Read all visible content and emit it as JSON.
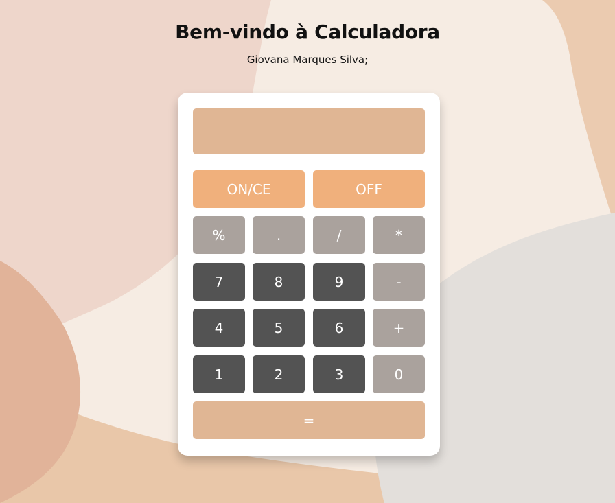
{
  "header": {
    "title": "Bem-vindo à Calculadora",
    "subtitle": "Giovana Marques Silva;"
  },
  "display": {
    "value": ""
  },
  "buttons": {
    "on_ce": "ON/CE",
    "off": "OFF",
    "percent": "%",
    "dot": ".",
    "divide": "/",
    "multiply": "*",
    "seven": "7",
    "eight": "8",
    "nine": "9",
    "minus": "-",
    "four": "4",
    "five": "5",
    "six": "6",
    "plus": "+",
    "one": "1",
    "two": "2",
    "three": "3",
    "zero": "0",
    "equals": "="
  },
  "colors": {
    "background": "#f6ece3",
    "display": "#e0b694",
    "control_button": "#f0b07c",
    "operator_button": "#aaa29d",
    "number_button": "#535353",
    "equals_button": "#e0b694"
  }
}
